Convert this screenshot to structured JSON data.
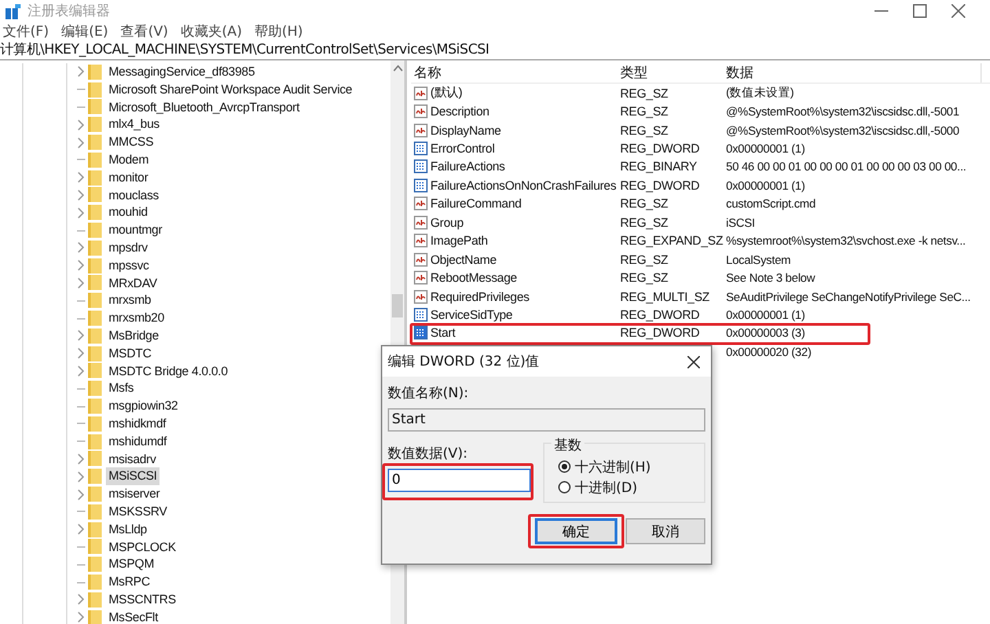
{
  "window": {
    "title": "注册表编辑器"
  },
  "menu": [
    "文件(F)",
    "编辑(E)",
    "查看(V)",
    "收藏夹(A)",
    "帮助(H)"
  ],
  "address": "计算机\\HKEY_LOCAL_MACHINE\\SYSTEM\\CurrentControlSet\\Services\\MSiSCSI",
  "tree": [
    {
      "label": "MessagingService_df83985",
      "expandable": true,
      "selected": false
    },
    {
      "label": "Microsoft SharePoint Workspace Audit Service",
      "expandable": false,
      "selected": false
    },
    {
      "label": "Microsoft_Bluetooth_AvrcpTransport",
      "expandable": false,
      "selected": false
    },
    {
      "label": "mlx4_bus",
      "expandable": true,
      "selected": false
    },
    {
      "label": "MMCSS",
      "expandable": true,
      "selected": false
    },
    {
      "label": "Modem",
      "expandable": false,
      "selected": false
    },
    {
      "label": "monitor",
      "expandable": true,
      "selected": false
    },
    {
      "label": "mouclass",
      "expandable": true,
      "selected": false
    },
    {
      "label": "mouhid",
      "expandable": true,
      "selected": false
    },
    {
      "label": "mountmgr",
      "expandable": false,
      "selected": false
    },
    {
      "label": "mpsdrv",
      "expandable": true,
      "selected": false
    },
    {
      "label": "mpssvc",
      "expandable": true,
      "selected": false
    },
    {
      "label": "MRxDAV",
      "expandable": true,
      "selected": false
    },
    {
      "label": "mrxsmb",
      "expandable": false,
      "selected": false
    },
    {
      "label": "mrxsmb20",
      "expandable": false,
      "selected": false
    },
    {
      "label": "MsBridge",
      "expandable": true,
      "selected": false
    },
    {
      "label": "MSDTC",
      "expandable": true,
      "selected": false
    },
    {
      "label": "MSDTC Bridge 4.0.0.0",
      "expandable": true,
      "selected": false
    },
    {
      "label": "Msfs",
      "expandable": false,
      "selected": false
    },
    {
      "label": "msgpiowin32",
      "expandable": false,
      "selected": false
    },
    {
      "label": "mshidkmdf",
      "expandable": false,
      "selected": false
    },
    {
      "label": "mshidumdf",
      "expandable": false,
      "selected": false
    },
    {
      "label": "msisadrv",
      "expandable": true,
      "selected": false
    },
    {
      "label": "MSiSCSI",
      "expandable": true,
      "selected": true
    },
    {
      "label": "msiserver",
      "expandable": true,
      "selected": false
    },
    {
      "label": "MSKSSRV",
      "expandable": false,
      "selected": false
    },
    {
      "label": "MsLldp",
      "expandable": true,
      "selected": false
    },
    {
      "label": "MSPCLOCK",
      "expandable": false,
      "selected": false
    },
    {
      "label": "MSPQM",
      "expandable": false,
      "selected": false
    },
    {
      "label": "MsRPC",
      "expandable": false,
      "selected": false
    },
    {
      "label": "MSSCNTRS",
      "expandable": true,
      "selected": false
    },
    {
      "label": "MsSecFlt",
      "expandable": true,
      "selected": false
    }
  ],
  "columns": [
    "名称",
    "类型",
    "数据"
  ],
  "rows": [
    {
      "kind": "string",
      "name": "(默认)",
      "type": "REG_SZ",
      "data": "(数值未设置)",
      "highlighted": false
    },
    {
      "kind": "string",
      "name": "Description",
      "type": "REG_SZ",
      "data": "@%SystemRoot%\\system32\\iscsidsc.dll,-5001",
      "highlighted": false
    },
    {
      "kind": "string",
      "name": "DisplayName",
      "type": "REG_SZ",
      "data": "@%SystemRoot%\\system32\\iscsidsc.dll,-5000",
      "highlighted": false
    },
    {
      "kind": "binary",
      "name": "ErrorControl",
      "type": "REG_DWORD",
      "data": "0x00000001 (1)",
      "highlighted": false
    },
    {
      "kind": "binary",
      "name": "FailureActions",
      "type": "REG_BINARY",
      "data": "50 46 00 00 01 00 00 00 01 00 00 00 03 00 00...",
      "highlighted": false
    },
    {
      "kind": "binary",
      "name": "FailureActionsOnNonCrashFailures",
      "type": "REG_DWORD",
      "data": "0x00000001 (1)",
      "highlighted": false
    },
    {
      "kind": "string",
      "name": "FailureCommand",
      "type": "REG_SZ",
      "data": "customScript.cmd",
      "highlighted": false
    },
    {
      "kind": "string",
      "name": "Group",
      "type": "REG_SZ",
      "data": "iSCSI",
      "highlighted": false
    },
    {
      "kind": "string",
      "name": "ImagePath",
      "type": "REG_EXPAND_SZ",
      "data": "%systemroot%\\system32\\svchost.exe -k netsv...",
      "highlighted": false
    },
    {
      "kind": "string",
      "name": "ObjectName",
      "type": "REG_SZ",
      "data": "LocalSystem",
      "highlighted": false
    },
    {
      "kind": "string",
      "name": "RebootMessage",
      "type": "REG_SZ",
      "data": "See Note 3 below",
      "highlighted": false
    },
    {
      "kind": "string",
      "name": "RequiredPrivileges",
      "type": "REG_MULTI_SZ",
      "data": "SeAuditPrivilege SeChangeNotifyPrivilege SeC...",
      "highlighted": false
    },
    {
      "kind": "binary",
      "name": "ServiceSidType",
      "type": "REG_DWORD",
      "data": "0x00000001 (1)",
      "highlighted": false
    },
    {
      "kind": "binary",
      "name": "Start",
      "type": "REG_DWORD",
      "data": "0x00000003 (3)",
      "highlighted": true
    },
    {
      "kind": "covered",
      "data": "0x00000020 (32)",
      "highlighted": false
    }
  ],
  "dialog": {
    "title": "编辑 DWORD (32 位)值",
    "name_label": "数值名称(N):",
    "name_value": "Start",
    "data_label": "数值数据(V):",
    "data_value": "0",
    "data_highlighted": true,
    "radix_label": "基数",
    "radios": [
      {
        "label": "十六进制(H)",
        "selected": true
      },
      {
        "label": "十进制(D)",
        "selected": false
      }
    ],
    "buttons": [
      {
        "label": "确定",
        "default": true,
        "highlighted": true
      },
      {
        "label": "取消",
        "default": false,
        "highlighted": false
      }
    ]
  }
}
